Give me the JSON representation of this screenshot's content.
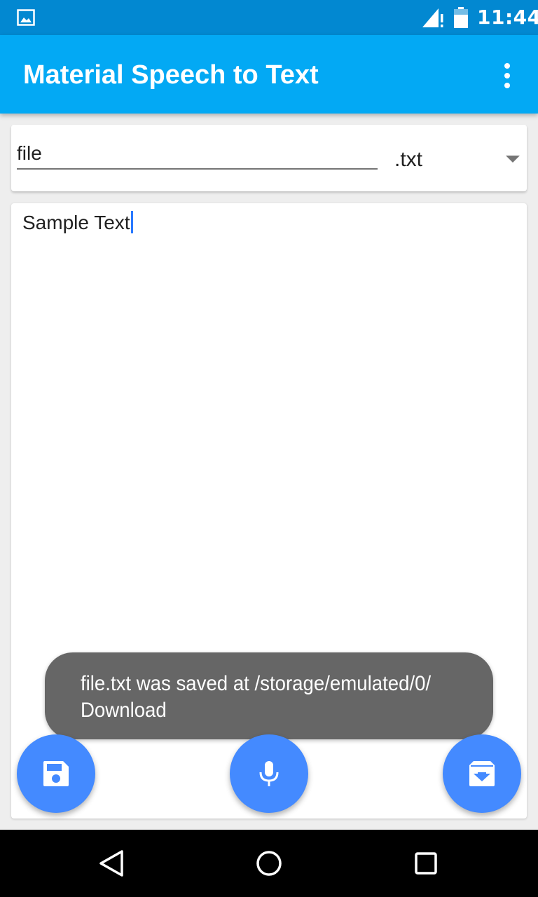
{
  "status_bar": {
    "time": "11:44",
    "icons": [
      "gallery-icon",
      "signal-icon",
      "battery-icon"
    ]
  },
  "app_bar": {
    "title": "Material Speech to Text",
    "overflow_icon": "more-vert-icon"
  },
  "file_card": {
    "filename_value": "file",
    "extension_selected": ".txt",
    "dropdown_icon": "dropdown-arrow-icon"
  },
  "editor": {
    "text": "Sample Text"
  },
  "toast": {
    "message": "file.txt was saved at /storage/emulated/0/ Download"
  },
  "fabs": {
    "save_icon": "save-icon",
    "mic_icon": "mic-icon",
    "archive_icon": "archive-icon"
  },
  "nav_bar": {
    "icons": [
      "back-icon",
      "home-icon",
      "recents-icon"
    ]
  },
  "colors": {
    "status_bar": "#0288d1",
    "app_bar": "#03a9f4",
    "fab": "#448aff",
    "toast": "#666666",
    "background": "#eeeeee"
  }
}
